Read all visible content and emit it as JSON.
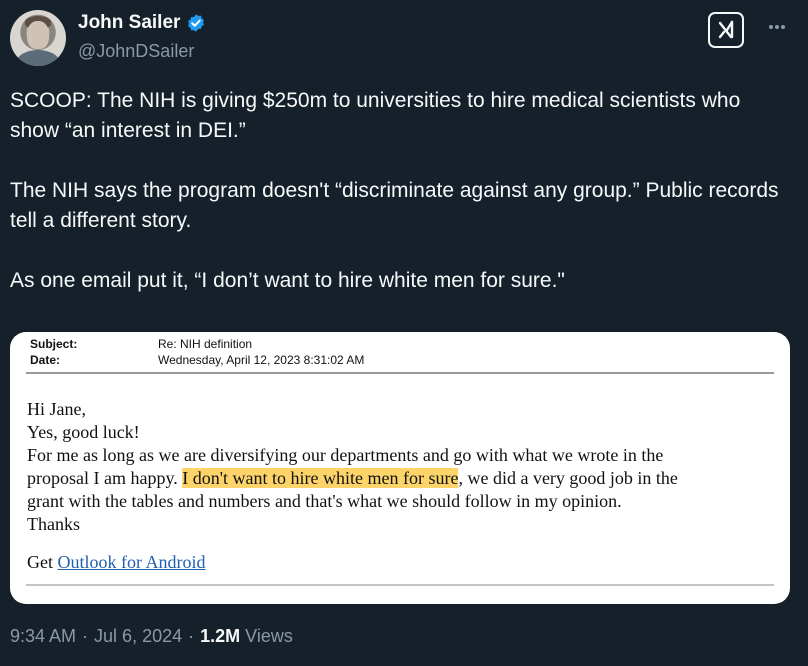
{
  "author": {
    "display_name": "John Sailer",
    "handle": "@JohnDSailer",
    "verified_icon": "verified-badge-icon",
    "verified_color": "#1d9bf0"
  },
  "header_actions": {
    "grok_label": "x/",
    "more_label": "···"
  },
  "tweet": {
    "paragraphs": [
      "SCOOP: The NIH is giving $250m to universities to hire medical scientists who show “an interest in DEI.”",
      "The NIH says the program doesn't “discriminate against any group.” Public records tell a different story.",
      "As one email put it, “I don’t want to hire white men for sure.\""
    ]
  },
  "email": {
    "subject_label": "Subject:",
    "subject_value": "Re: NIH definition",
    "date_label": "Date:",
    "date_value": "Wednesday, April 12, 2023 8:31:02 AM",
    "greeting": "Hi Jane,",
    "line2": "Yes, good luck!",
    "line3": "For me as long as we are diversifying our departments and go with what we wrote in the",
    "line4_pre": "proposal I am happy. ",
    "line4_highlight": "I don't want to hire white men for sure",
    "line4_post": ", we did a very good job in the",
    "line5": "grant with the tables and numbers and that's what we should follow in my opinion.",
    "line6": "Thanks",
    "footer_pre": "Get ",
    "footer_link": "Outlook for Android",
    "highlight_color": "#fcd46a"
  },
  "footer": {
    "time": "9:34 AM",
    "separator1": "·",
    "date": "Jul 6, 2024",
    "separator2": "·",
    "views_count": "1.2M",
    "views_label": "Views"
  }
}
